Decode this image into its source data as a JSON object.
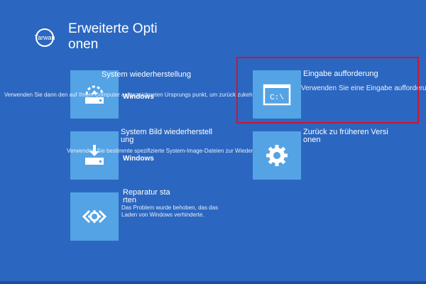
{
  "header": {
    "back_label": "Tarwan",
    "title": "Erweiterte Opti\nonen"
  },
  "options": {
    "system_restore": {
      "title": "System wiederherstellung",
      "description": "Verwenden Sie dann den auf Ihrem Computer aufgezeichneten Ursprungs punkt, um zurück zukehren",
      "os_label": "Windows"
    },
    "system_image": {
      "title": "System Bild wiederherstell\nung",
      "description": "Verwenden Sie bestimmte spezifizierte System-Image-Dateien zur Wiederherstellung",
      "os_label": "Windows"
    },
    "startup_repair": {
      "title": "Reparatur sta\nrten",
      "description": "Das Problem wurde behoben, das das\nLaden von Windows verhinderte."
    },
    "command_prompt": {
      "title": "Eingabe aufforderung",
      "description": "Verwenden Sie eine Eingabe aufforderung",
      "icon_text": "C:\\"
    },
    "previous_version": {
      "title": "Zurück zu früheren Versi\nonen",
      "description": ""
    }
  },
  "icons": {
    "back": "back-arrow-icon",
    "system_restore": "restore-icon",
    "system_image": "drive-download-icon",
    "startup_repair": "code-gear-icon",
    "command_prompt": "terminal-icon",
    "previous_version": "gear-icon"
  },
  "colors": {
    "background": "#2b67c0",
    "tile": "#54a3e5",
    "highlight": "#d4112e"
  }
}
